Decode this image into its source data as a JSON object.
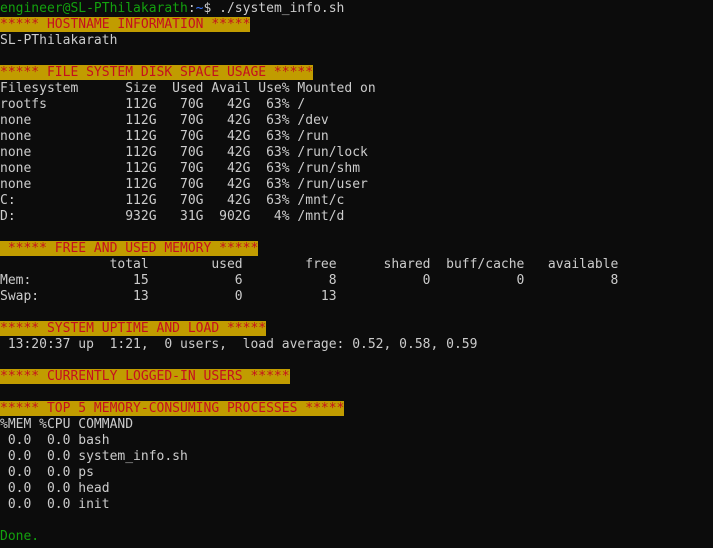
{
  "prompt": {
    "user_host": "engineer@SL-PThilakarath",
    "sep": ":",
    "path": "~",
    "symbol": "$",
    "command": " ./system_info.sh"
  },
  "sections": {
    "hostname": {
      "banner": "***** HOSTNAME INFORMATION *****",
      "value": "SL-PThilakarath"
    },
    "disk": {
      "banner": "***** FILE SYSTEM DISK SPACE USAGE *****",
      "header": "Filesystem      Size  Used Avail Use% Mounted on",
      "rows": [
        "rootfs          112G   70G   42G  63% /",
        "none            112G   70G   42G  63% /dev",
        "none            112G   70G   42G  63% /run",
        "none            112G   70G   42G  63% /run/lock",
        "none            112G   70G   42G  63% /run/shm",
        "none            112G   70G   42G  63% /run/user",
        "C:              112G   70G   42G  63% /mnt/c",
        "D:              932G   31G  902G   4% /mnt/d"
      ]
    },
    "memory": {
      "banner": " ***** FREE AND USED MEMORY *****",
      "header": "              total        used        free      shared  buff/cache   available",
      "rows": [
        "Mem:             15           6           8           0           0           8",
        "Swap:            13           0          13"
      ]
    },
    "uptime": {
      "banner": "***** SYSTEM UPTIME AND LOAD *****",
      "value": " 13:20:37 up  1:21,  0 users,  load average: 0.52, 0.58, 0.59"
    },
    "users": {
      "banner": "***** CURRENTLY LOGGED-IN USERS *****"
    },
    "processes": {
      "banner": "***** TOP 5 MEMORY-CONSUMING PROCESSES *****",
      "header": "%MEM %CPU COMMAND",
      "rows": [
        " 0.0  0.0 bash",
        " 0.0  0.0 system_info.sh",
        " 0.0  0.0 ps",
        " 0.0  0.0 head",
        " 0.0  0.0 init"
      ]
    }
  },
  "footer": {
    "done": "Done."
  },
  "colors": {
    "background": "#0c0c0c",
    "text": "#cccccc",
    "prompt_green": "#13a10e",
    "path_blue": "#3b78ff",
    "banner_bg": "#c19c00",
    "banner_fg": "#c50f1f"
  }
}
